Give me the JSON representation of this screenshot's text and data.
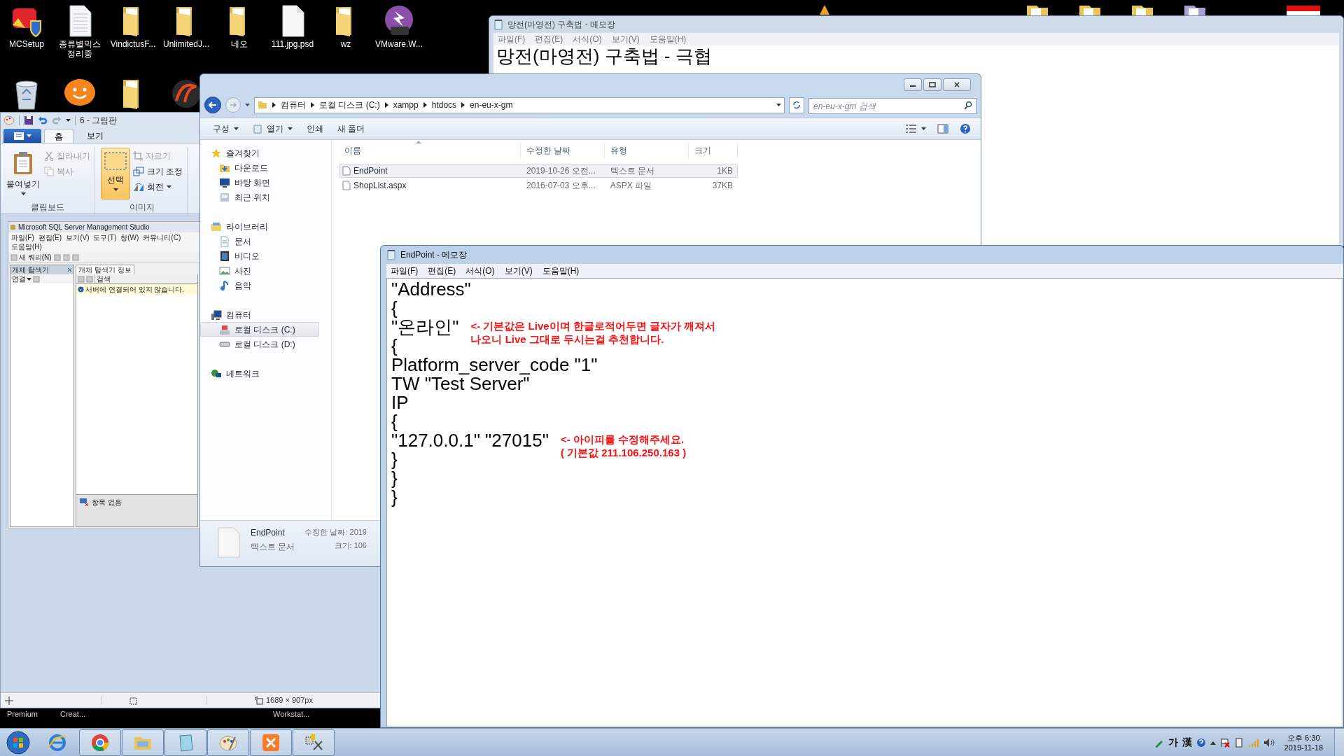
{
  "desktop": {
    "icons": [
      {
        "label": "MCSetup",
        "kind": "app"
      },
      {
        "label": "종류별믹스 정리중",
        "kind": "document"
      },
      {
        "label": "VindictusF...",
        "kind": "folder"
      },
      {
        "label": "UnlimitedJ...",
        "kind": "folder"
      },
      {
        "label": "네오",
        "kind": "folder"
      },
      {
        "label": "111.jpg.psd",
        "kind": "file"
      },
      {
        "label": "wz",
        "kind": "folder"
      },
      {
        "label": "VMware.W...",
        "kind": "archive"
      }
    ],
    "second_row": [
      {
        "kind": "recycle"
      },
      {
        "kind": "chat"
      },
      {
        "kind": "folder"
      },
      {
        "kind": "game"
      }
    ],
    "partial_labels": [
      "Premium",
      "Creat...",
      "Workstat..."
    ]
  },
  "back_notepad": {
    "title": "망전(마영전) 구축법 - 메모장",
    "menu": [
      "파일(F)",
      "편집(E)",
      "서식(O)",
      "보기(V)",
      "도움말(H)"
    ],
    "lines": [
      "망전(마영전) 구축법 - 극협"
    ]
  },
  "paint": {
    "title": "6 - 그림판",
    "tabs": [
      {
        "label": "홈",
        "selected": true
      },
      {
        "label": "보기",
        "selected": false
      }
    ],
    "groups": [
      {
        "label": "클립보드",
        "large": {
          "label": "붙여넣기",
          "kind": "paste",
          "selected": false
        },
        "small": [
          {
            "label": "잘라내기",
            "kind": "cut",
            "disabled": true,
            "has_menu": false
          },
          {
            "label": "복사",
            "kind": "copy",
            "disabled": true,
            "has_menu": false
          }
        ]
      },
      {
        "label": "이미지",
        "large": {
          "label": "선택",
          "kind": "select",
          "selected": true
        },
        "small": [
          {
            "label": "자르기",
            "kind": "crop",
            "disabled": true,
            "has_menu": false
          },
          {
            "label": "크기 조정",
            "kind": "resize",
            "disabled": false,
            "has_menu": false
          },
          {
            "label": "회전",
            "kind": "rotate",
            "disabled": false,
            "has_menu": true
          }
        ]
      }
    ],
    "canvas_screenshot": {
      "title": "Microsoft SQL Server Management Studio",
      "menu": [
        "파일(F)",
        "편집(E)",
        "보기(V)",
        "도구(T)",
        "창(W)",
        "커뮤니티(C)",
        "도움말(H)"
      ],
      "toolbar_button": "새 쿼리(N)",
      "explorer_title": "개체 탐색기",
      "connect": "연결",
      "details_tab": "개체 탐색기 정보",
      "search": "검색",
      "info": "서버에 연결되어 있지 않습니다.",
      "empty": "항목 없음"
    },
    "status": {
      "size": "1689 × 907px"
    }
  },
  "explorer": {
    "breadcrumb": [
      "컴퓨터",
      "로컬 디스크 (C:)",
      "xampp",
      "htdocs",
      "en-eu-x-gm"
    ],
    "search": {
      "placeholder": "en-eu-x-gm 검색"
    },
    "toolbar": [
      {
        "label": "구성",
        "has_menu": true,
        "kind": "text"
      },
      {
        "label": "열기",
        "has_menu": true,
        "kind": "open"
      },
      {
        "label": "인쇄",
        "has_menu": false,
        "kind": "text"
      },
      {
        "label": "새 폴더",
        "has_menu": false,
        "kind": "text"
      }
    ],
    "nav": [
      {
        "label": "즐겨찾기",
        "kind": "star",
        "selected": false,
        "children": [
          {
            "label": "다운로드",
            "kind": "downloads",
            "selected": false
          },
          {
            "label": "바탕 화면",
            "kind": "desktop",
            "selected": false
          },
          {
            "label": "최근 위치",
            "kind": "recent",
            "selected": false
          }
        ]
      },
      {
        "label": "라이브러리",
        "kind": "library",
        "selected": false,
        "children": [
          {
            "label": "문서",
            "kind": "doc",
            "selected": false
          },
          {
            "label": "비디오",
            "kind": "video",
            "selected": false
          },
          {
            "label": "사진",
            "kind": "picture",
            "selected": false
          },
          {
            "label": "음악",
            "kind": "music",
            "selected": false
          }
        ]
      },
      {
        "label": "컴퓨터",
        "kind": "computer",
        "selected": false,
        "children": [
          {
            "label": "로컬 디스크 (C:)",
            "kind": "system_drive",
            "selected": true
          },
          {
            "label": "로컬 디스크 (D:)",
            "kind": "drive",
            "selected": false
          }
        ]
      },
      {
        "label": "네트워크",
        "kind": "network",
        "selected": false
      }
    ],
    "columns": [
      "이름",
      "수정한 날짜",
      "유형",
      "크기"
    ],
    "rows": [
      {
        "name": "EndPoint",
        "modified": "2019-10-26 오전...",
        "type": "텍스트 문서",
        "size": "1KB",
        "selected": true
      },
      {
        "name": "ShopList.aspx",
        "modified": "2016-07-03 오후...",
        "type": "ASPX 파일",
        "size": "37KB",
        "selected": false
      }
    ],
    "details": {
      "name": "EndPoint",
      "type": "텍스트 문서",
      "modified": "수정한 날짜: 2019",
      "size": "크기: 106"
    }
  },
  "notepad": {
    "title": "EndPoint - 메모장",
    "menu": [
      "파일(F)",
      "편집(E)",
      "서식(O)",
      "보기(V)",
      "도움말(H)"
    ],
    "lines": [
      {
        "text": "\"Address\""
      },
      {
        "text": "{"
      },
      {
        "text": "\"온라인\"",
        "note": [
          "<- 기본값은 Live이며 한글로적어두면 글자가 깨져서",
          "나오니 Live 그대로 두시는걸 추천합니다."
        ]
      },
      {
        "text": "{"
      },
      {
        "text": "Platform_server_code \"1\""
      },
      {
        "text": "TW \"Test Server\""
      },
      {
        "text": "IP"
      },
      {
        "text": "{"
      },
      {
        "text": "\"127.0.0.1\" \"27015\"",
        "note": [
          "<- 아이피를 수정해주세요.",
          "( 기본값 211.106.250.163 )"
        ]
      },
      {
        "text": "}"
      },
      {
        "text": "}"
      },
      {
        "text": "}"
      }
    ]
  },
  "taskbar": {
    "apps": [
      {
        "kind": "ie",
        "running": false
      },
      {
        "kind": "chrome",
        "running": true
      },
      {
        "kind": "explorer",
        "running": true
      },
      {
        "kind": "notepad",
        "running": true
      },
      {
        "kind": "paint",
        "running": true
      },
      {
        "kind": "xampp",
        "running": true
      },
      {
        "kind": "tool",
        "running": true
      }
    ],
    "ime": [
      "가",
      "漢"
    ],
    "time": "오후 6:30",
    "date": "2019-11-18"
  }
}
